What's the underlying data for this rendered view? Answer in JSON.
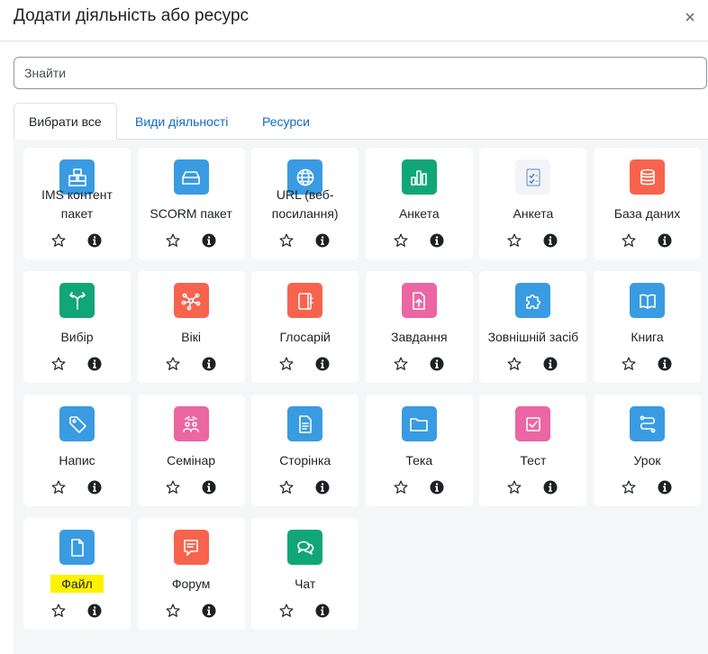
{
  "modal": {
    "title": "Додати діяльність або ресурс",
    "close_label": "×"
  },
  "search": {
    "placeholder": "Знайти"
  },
  "tabs": [
    {
      "label": "Вибрати все",
      "active": true
    },
    {
      "label": "Види діяльності",
      "active": false
    },
    {
      "label": "Ресурси",
      "active": false
    }
  ],
  "colors": {
    "blue": "#399be2",
    "red": "#f7634d",
    "green": "#11a676",
    "pink": "#eb66a2",
    "link": "#0f6cbf",
    "highlight": "#fff200"
  },
  "tiles": [
    {
      "label": "IMS контент пакет",
      "icon": "ims-package-icon",
      "color": "blue"
    },
    {
      "label": "SCORM пакет",
      "icon": "scorm-package-icon",
      "color": "blue"
    },
    {
      "label": "URL (веб-посилання)",
      "icon": "globe-icon",
      "color": "blue"
    },
    {
      "label": "Анкета",
      "icon": "bar-chart-icon",
      "color": "green"
    },
    {
      "label": "Анкета",
      "icon": "questionnaire-icon",
      "color": "none"
    },
    {
      "label": "База даних",
      "icon": "database-icon",
      "color": "red"
    },
    {
      "label": "Вибір",
      "icon": "signpost-icon",
      "color": "green"
    },
    {
      "label": "Вікі",
      "icon": "wiki-network-icon",
      "color": "red"
    },
    {
      "label": "Глосарій",
      "icon": "glossary-book-icon",
      "color": "red"
    },
    {
      "label": "Завдання",
      "icon": "assignment-upload-icon",
      "color": "pink"
    },
    {
      "label": "Зовнішній засіб",
      "icon": "puzzle-icon",
      "color": "blue"
    },
    {
      "label": "Книга",
      "icon": "open-book-icon",
      "color": "blue"
    },
    {
      "label": "Напис",
      "icon": "tag-icon",
      "color": "blue"
    },
    {
      "label": "Семінар",
      "icon": "workshop-people-icon",
      "color": "pink"
    },
    {
      "label": "Сторінка",
      "icon": "page-icon",
      "color": "blue"
    },
    {
      "label": "Тека",
      "icon": "folder-icon",
      "color": "blue"
    },
    {
      "label": "Тест",
      "icon": "quiz-check-icon",
      "color": "pink"
    },
    {
      "label": "Урок",
      "icon": "lesson-path-icon",
      "color": "blue"
    },
    {
      "label": "Файл",
      "icon": "file-icon",
      "color": "blue",
      "highlighted": true
    },
    {
      "label": "Форум",
      "icon": "forum-icon",
      "color": "red"
    },
    {
      "label": "Чат",
      "icon": "chat-icon",
      "color": "green"
    }
  ]
}
